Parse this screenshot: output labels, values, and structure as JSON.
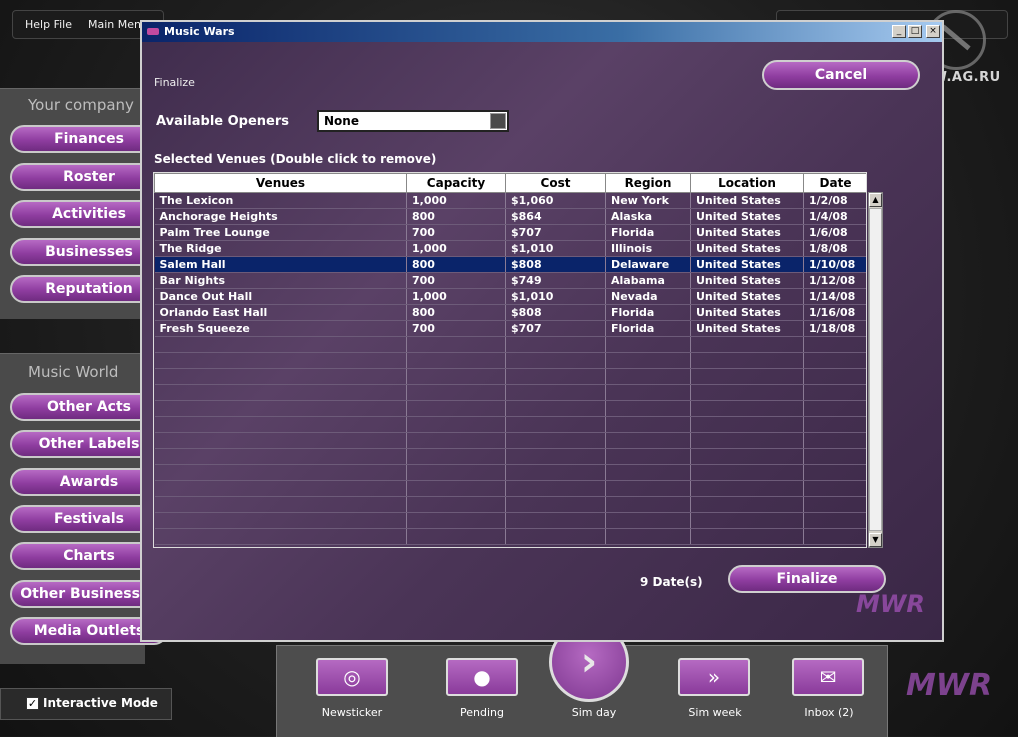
{
  "topbar": {
    "help": "Help File",
    "main_menu": "Main Menu"
  },
  "watermark": {
    "site": "WWW.AG.RU"
  },
  "sidebar": {
    "company_title": "Your company",
    "company_items": [
      "Finances",
      "Roster",
      "Activities",
      "Businesses",
      "Reputation"
    ],
    "world_title": "Music World",
    "world_items": [
      "Other Acts",
      "Other Labels",
      "Awards",
      "Festivals",
      "Charts",
      "Other Businesses",
      "Media Outlets"
    ]
  },
  "window": {
    "title": "Music Wars",
    "subtitle": "Finalize",
    "cancel_label": "Cancel",
    "openers_label": "Available Openers",
    "openers_value": "None",
    "venues_label": "Selected Venues (Double click to remove)",
    "columns": [
      "Venues",
      "Capacity",
      "Cost",
      "Region",
      "Location",
      "Date"
    ],
    "rows": [
      [
        "The Lexicon",
        "1,000",
        "$1,060",
        "New York",
        "United States",
        "1/2/08"
      ],
      [
        "Anchorage Heights",
        "800",
        "$864",
        "Alaska",
        "United States",
        "1/4/08"
      ],
      [
        "Palm Tree Lounge",
        "700",
        "$707",
        "Florida",
        "United States",
        "1/6/08"
      ],
      [
        "The Ridge",
        "1,000",
        "$1,010",
        "Illinois",
        "United States",
        "1/8/08"
      ],
      [
        "Salem Hall",
        "800",
        "$808",
        "Delaware",
        "United States",
        "1/10/08"
      ],
      [
        "Bar Nights",
        "700",
        "$749",
        "Alabama",
        "United States",
        "1/12/08"
      ],
      [
        "Dance Out Hall",
        "1,000",
        "$1,010",
        "Nevada",
        "United States",
        "1/14/08"
      ],
      [
        "Orlando East Hall",
        "800",
        "$808",
        "Florida",
        "United States",
        "1/16/08"
      ],
      [
        "Fresh Squeeze",
        "700",
        "$707",
        "Florida",
        "United States",
        "1/18/08"
      ]
    ],
    "selected_row": 4,
    "empty_rows": 13,
    "dates_count": "9 Date(s)",
    "finalize_label": "Finalize",
    "logo": "MWR"
  },
  "bottombar": {
    "newsticker": "Newsticker",
    "pending": "Pending",
    "sim_day": "Sim day",
    "sim_week": "Sim week",
    "inbox": "Inbox (2)"
  },
  "interactive_mode": {
    "label": "Interactive Mode",
    "checked": true
  },
  "corner_logo": "MWR",
  "colors": {
    "accent": "#8f3da0",
    "selection": "#0a246a",
    "window_bg": "#4a3456"
  }
}
